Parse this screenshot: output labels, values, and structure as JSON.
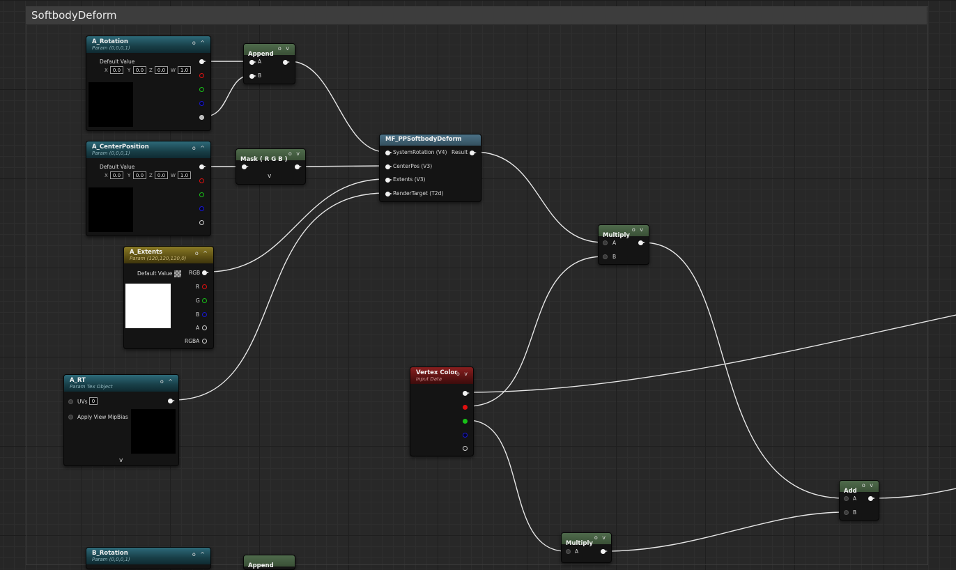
{
  "comment": {
    "title": "SoftbodyDeform"
  },
  "icons": {
    "header_pin": "o",
    "header_collapse": "^",
    "header_expand": "v",
    "expander": "v"
  },
  "nodes": {
    "a_rotation": {
      "title": "A_Rotation",
      "subtitle": "Param (0,0,0,1)",
      "default_label": "Default Value",
      "x_label": "X",
      "x": "0.0",
      "y_label": "Y",
      "y": "0.0",
      "z_label": "Z",
      "z": "0.0",
      "w_label": "W",
      "w": "1.0"
    },
    "append_top": {
      "title": "Append",
      "pin_a": "A",
      "pin_b": "B"
    },
    "a_centerposition": {
      "title": "A_CenterPosition",
      "subtitle": "Param (0,0,0,1)",
      "default_label": "Default Value",
      "x_label": "X",
      "x": "0.0",
      "y_label": "Y",
      "y": "0.0",
      "z_label": "Z",
      "z": "0.0",
      "w_label": "W",
      "w": "1.0"
    },
    "mask": {
      "title": "Mask ( R G B )"
    },
    "a_extents": {
      "title": "A_Extents",
      "subtitle": "Param (120,120,120,0)",
      "default_label": "Default Value",
      "out_rgb": "RGB",
      "out_r": "R",
      "out_g": "G",
      "out_b": "B",
      "out_a": "A",
      "out_rgba": "RGBA"
    },
    "a_rt": {
      "title": "A_RT",
      "subtitle": "Param Tex Object",
      "uvs_label": "UVs",
      "uvs_value": "0",
      "mip_label": "Apply View MipBias"
    },
    "mf_softbody": {
      "title": "MF_PPSoftbodyDeform",
      "in_1": "SystemRotation (V4)",
      "in_2": "CenterPos (V3)",
      "in_3": "Extents (V3)",
      "in_4": "RenderTarget (T2d)",
      "out_1": "Result"
    },
    "multiply_1": {
      "title": "Multiply",
      "pin_a": "A",
      "pin_b": "B"
    },
    "vertex_color": {
      "title": "Vertex Color",
      "subtitle": "Input Data"
    },
    "add": {
      "title": "Add",
      "pin_a": "A",
      "pin_b": "B"
    },
    "multiply_2": {
      "title": "Multiply",
      "pin_a": "A"
    },
    "b_rotation": {
      "title": "B_Rotation",
      "subtitle": "Param (0,0,0,1)"
    },
    "append_bottom": {
      "title": "Append"
    }
  }
}
